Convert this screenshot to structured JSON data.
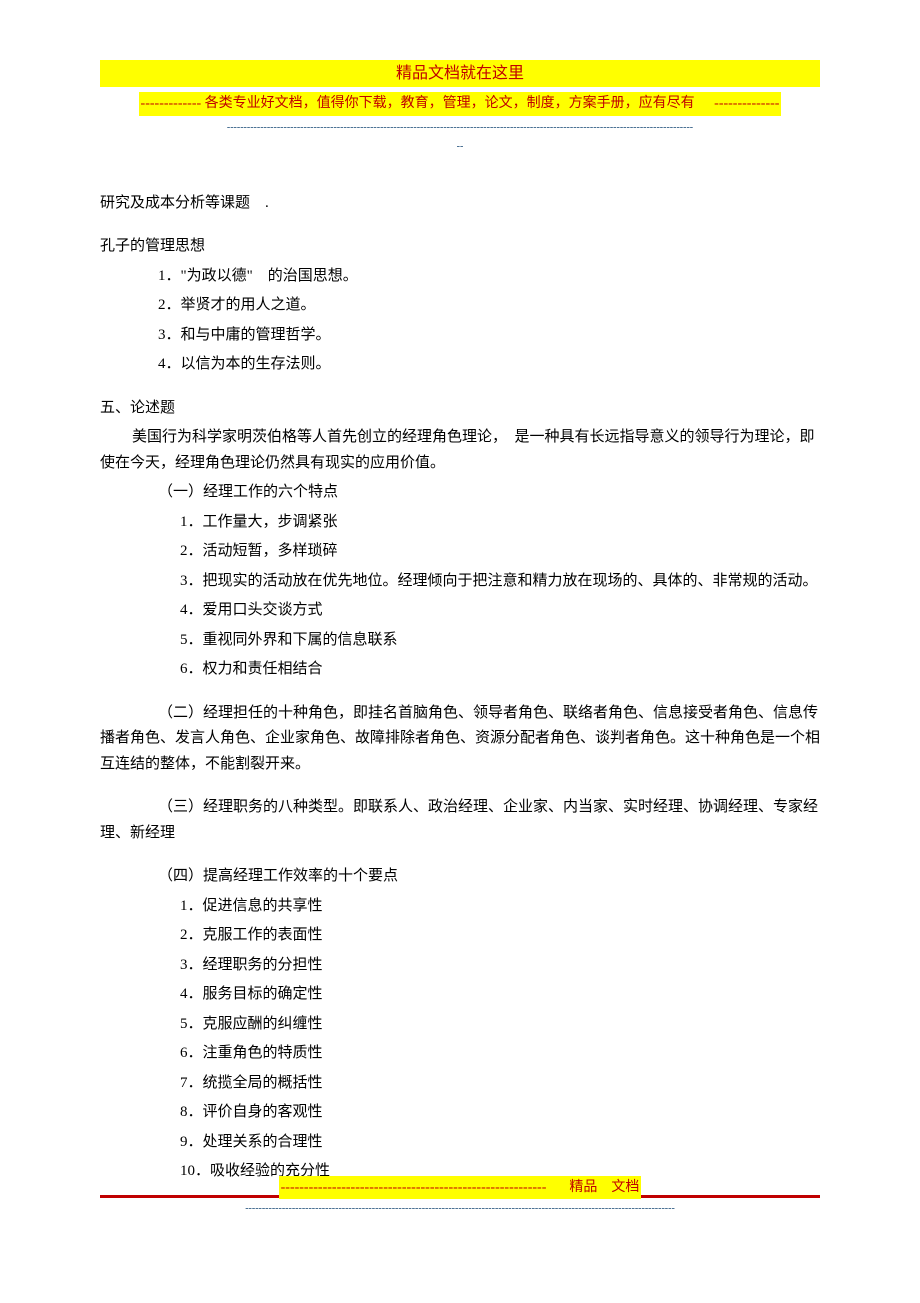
{
  "header": {
    "title": "精品文档就在这里",
    "sub_left_dashes": "-------------",
    "sub_text": " 各类专业好文档，值得你下载，教育，管理，论文，制度，方案手册，应有尽有 ",
    "sub_right_dashes": "--------------",
    "divider1": "--------------------------------------------------------------------------------------------------------------------------------------------",
    "divider2": "--"
  },
  "body": {
    "p1": "研究及成本分析等课题　.",
    "s1_title": "孔子的管理思想",
    "s1_items": [
      "1．\"为政以德\"　的治国思想。",
      "2．举贤才的用人之道。",
      "3．和与中庸的管理哲学。",
      "4．以信为本的生存法则。"
    ],
    "s2_title": "五、论述题",
    "s2_p1": "美国行为科学家明茨伯格等人首先创立的经理角色理论，　是一种具有长远指导意义的领导行为理论，即使在今天，经理角色理论仍然具有现实的应用价值。",
    "s2_a_title": "（一）经理工作的六个特点",
    "s2_a_items12": [
      "1．工作量大，步调紧张",
      "2．活动短暂，多样琐碎"
    ],
    "s2_a_item3": "3．把现实的活动放在优先地位。经理倾向于把注意和精力放在现场的、具体的、非常规的活动。",
    "s2_a_items456": [
      "4．爱用口头交谈方式",
      "5．重视同外界和下属的信息联系",
      "6．权力和责任相结合"
    ],
    "s2_b": "（二）经理担任的十种角色，即挂名首脑角色、领导者角色、联络者角色、信息接受者角色、信息传播者角色、发言人角色、企业家角色、故障排除者角色、资源分配者角色、谈判者角色。这十种角色是一个相互连结的整体，不能割裂开来。",
    "s2_c": "（三）经理职务的八种类型。即联系人、政治经理、企业家、内当家、实时经理、协调经理、专家经理、新经理",
    "s2_d_title": "（四）提高经理工作效率的十个要点",
    "s2_d_items": [
      "1．促进信息的共享性",
      "2．克服工作的表面性",
      "3．经理职务的分担性",
      "4．服务目标的确定性",
      "5．克服应酬的纠缠性",
      "6．注重角色的特质性",
      "7．统揽全局的概括性",
      "8．评价自身的客观性",
      "9．处理关系的合理性",
      "10．吸收经验的充分性"
    ]
  },
  "footer": {
    "left_dashes": "---------------------------------------------------------",
    "label": "精品　文档",
    "divider": "---------------------------------------------------------------------------------------------------------------------------------"
  }
}
